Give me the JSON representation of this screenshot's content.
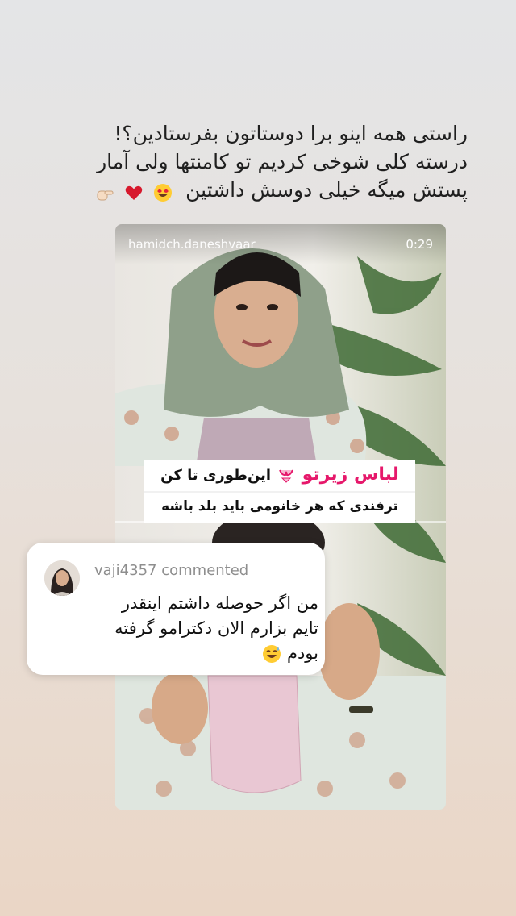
{
  "story": {
    "caption_lines": [
      "راستی همه اینو برا دوستاتون بفرستادین؟!",
      "درسته کلی شوخی کردیم تو کامنتها ولی آمار",
      "پستش میگه خیلی دوسش داشتین"
    ],
    "caption_emojis": [
      "heart-eyes-emoji",
      "red-heart-emoji",
      "pointing-hand-emoji"
    ]
  },
  "post": {
    "handle": "hamidch.daneshvaar",
    "duration": "0:29",
    "banner_title_pink": "لباس زیرتو",
    "banner_title_rest": "این‌طوری تا کن",
    "banner_subtitle": "ترفندی که هر خانومی باید بلد باشه",
    "banner_icon": "bikini-emoji"
  },
  "comment": {
    "username": "vaji4357 commented",
    "text_lines": [
      "من اگر حوصله داشتم اینقدر",
      "تایم بزارم الان دکترامو گرفته",
      "بودم"
    ],
    "emoji": "sweat-smile-emoji"
  },
  "colors": {
    "banner_pink": "#e6186b",
    "caption_text": "#1f1f1f",
    "username_gray": "#8e8e8e"
  }
}
